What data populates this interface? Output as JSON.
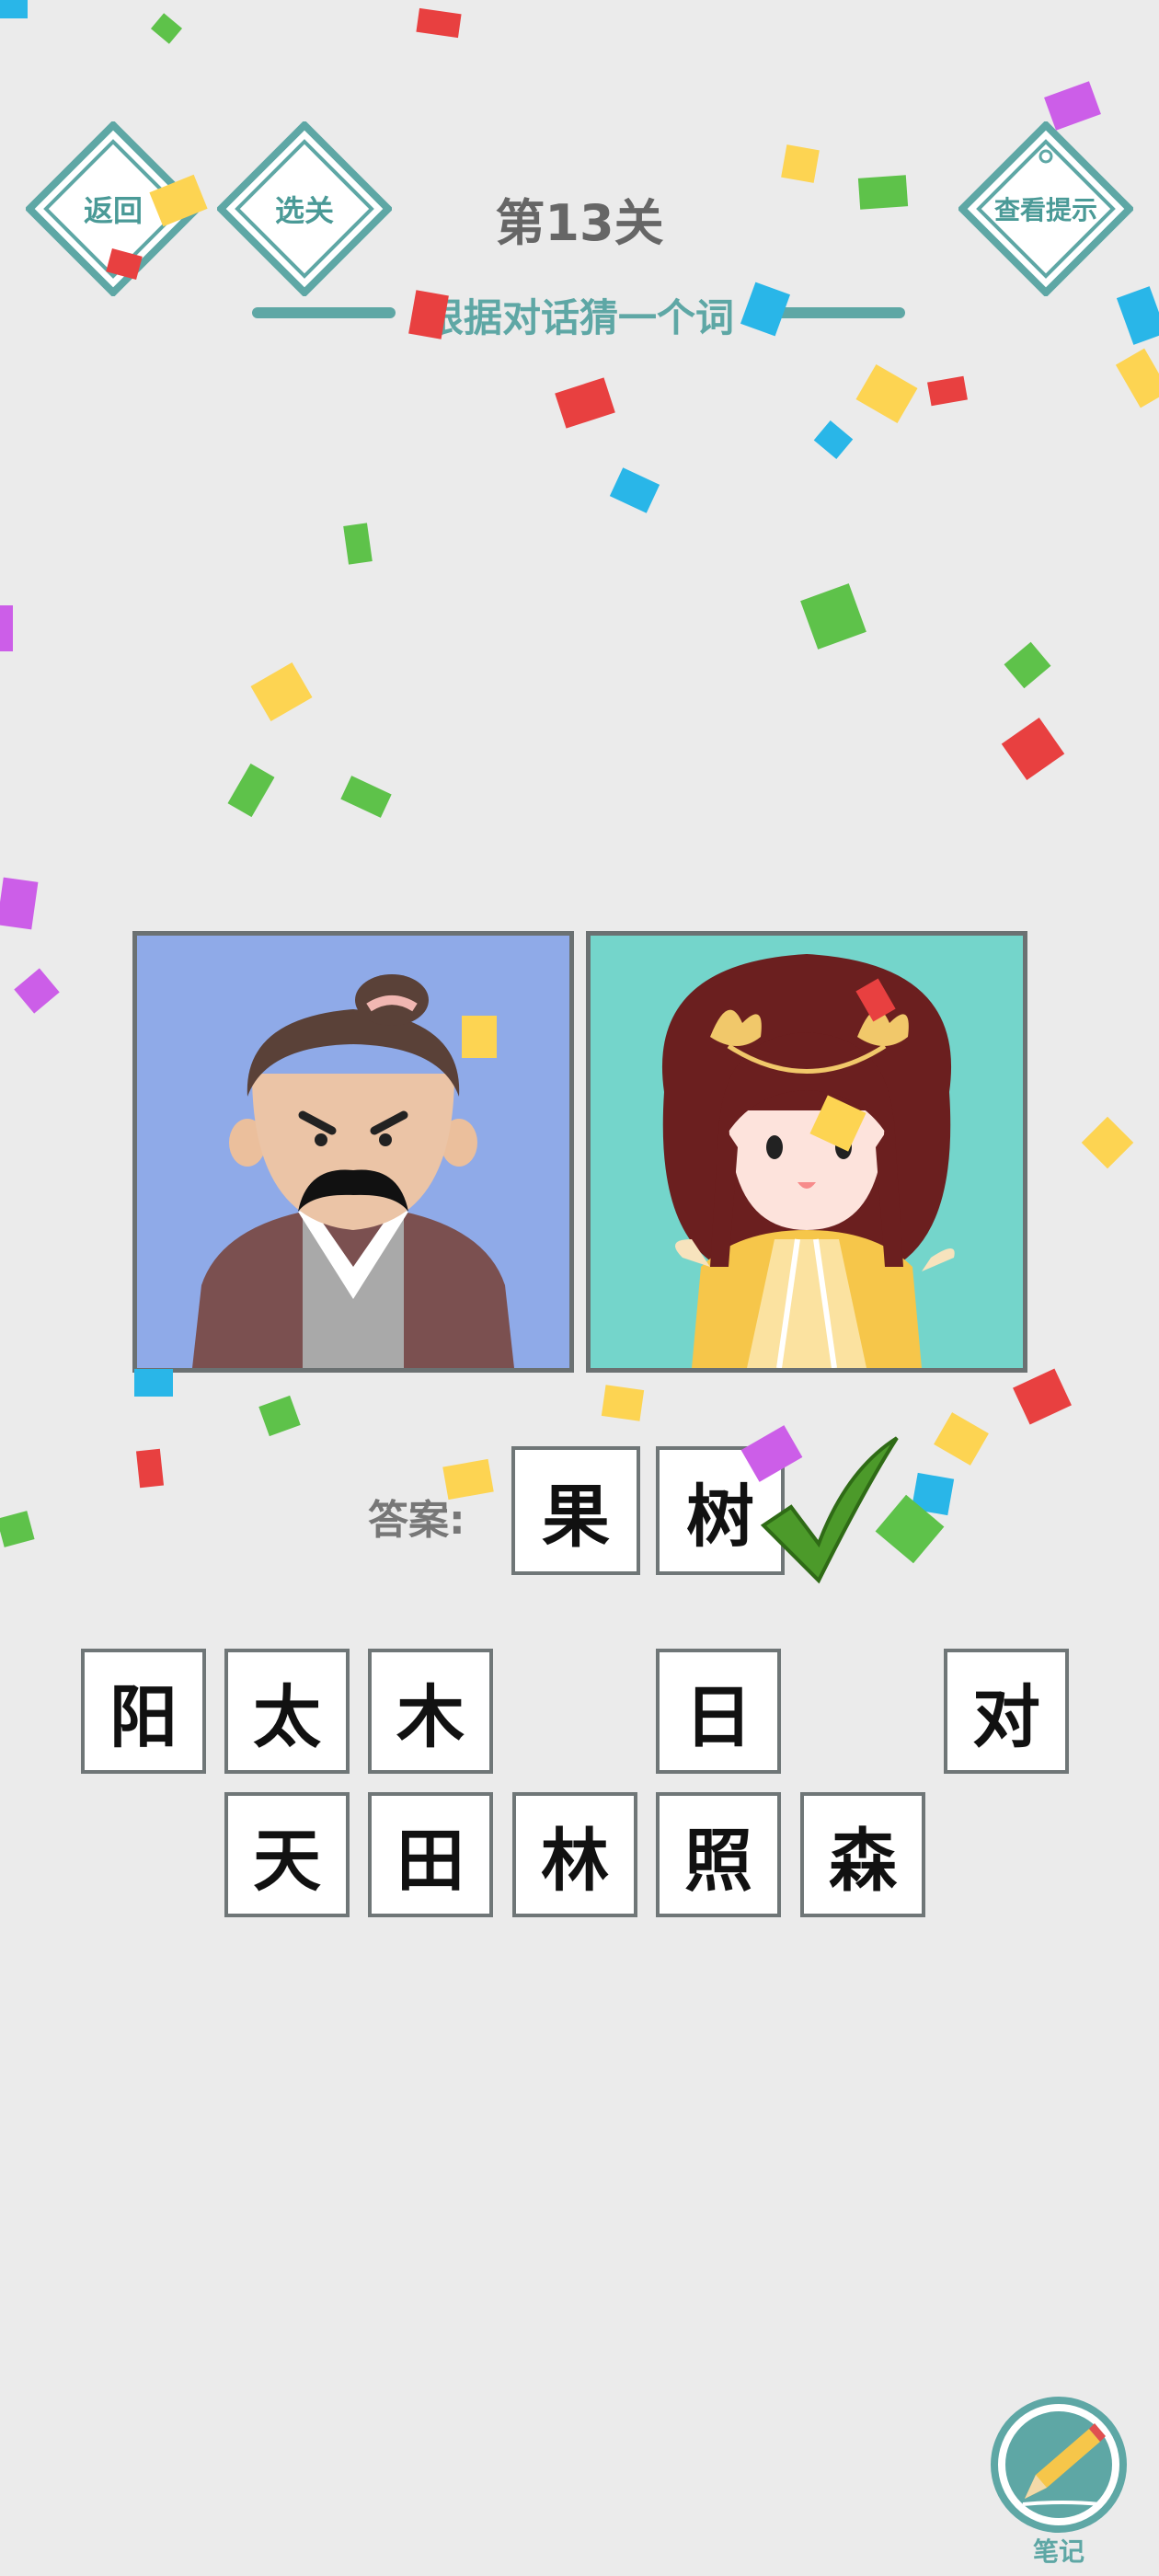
{
  "header": {
    "back_label": "返回",
    "select_level_label": "选关",
    "level_title": "第13关",
    "hint_label": "查看提示",
    "subtitle": "根据对话猜一个词"
  },
  "panels": [
    {
      "name": "angry-old-man",
      "bg": "#8faae8"
    },
    {
      "name": "princess",
      "bg": "#74d5cb"
    }
  ],
  "answer": {
    "label": "答案:",
    "chars": [
      "果",
      "树"
    ],
    "status": "correct"
  },
  "choices": {
    "row1": [
      "阳",
      "太",
      "木",
      "",
      "日",
      "",
      "对"
    ],
    "row2": [
      "天",
      "田",
      "林",
      "照",
      "森"
    ]
  },
  "notes": {
    "label": "笔记"
  },
  "colors": {
    "background": "#ebebeb",
    "teal": "#5ea7a5",
    "check_green": "#4c9a2a"
  }
}
